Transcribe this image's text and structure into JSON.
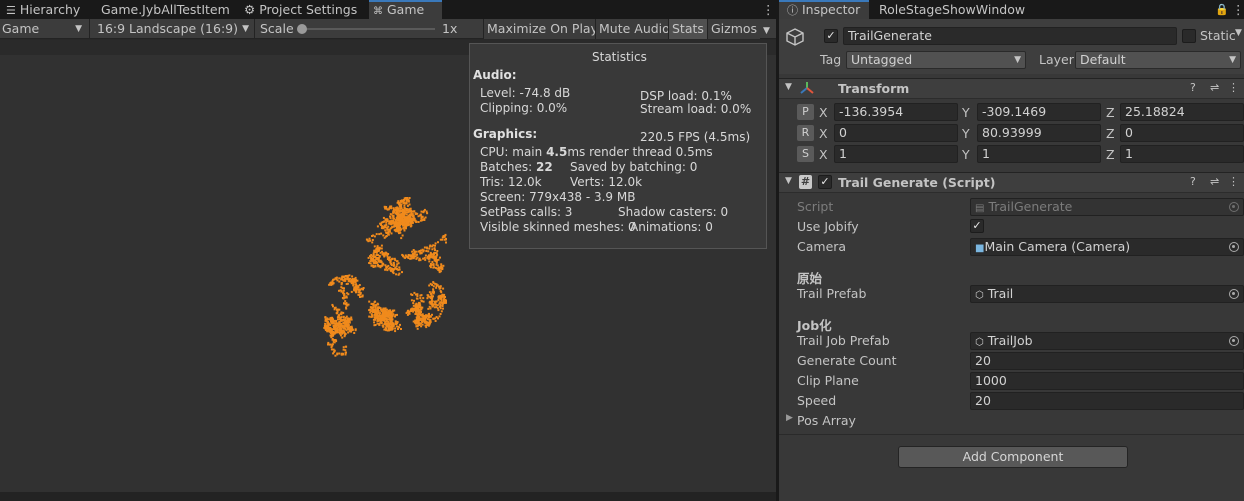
{
  "tabs_left": {
    "hierarchy": "Hierarchy",
    "game_jyb": "Game.JybAllTestItem",
    "project_settings": "Project Settings",
    "game": "Game"
  },
  "toolbar": {
    "display": "Game",
    "aspect": "16:9 Landscape (16:9)",
    "scale_label": "Scale",
    "scale_value": "1x",
    "maximize": "Maximize On Play",
    "mute": "Mute Audio",
    "stats": "Stats",
    "gizmos": "Gizmos"
  },
  "stats": {
    "title": "Statistics",
    "audio_header": "Audio:",
    "level": "Level: -74.8 dB",
    "clipping": "Clipping: 0.0%",
    "dsp": "DSP load: 0.1%",
    "stream": "Stream load: 0.0%",
    "graphics_header": "Graphics:",
    "fps": "220.5 FPS (4.5ms)",
    "cpu_prefix": "CPU: main ",
    "cpu_main": "4.5",
    "cpu_suffix": "ms  render thread 0.5ms",
    "batches_prefix": "Batches: ",
    "batches": "22",
    "saved": "Saved by batching: 0",
    "tris": "Tris: 12.0k",
    "verts": "Verts: 12.0k",
    "screen": "Screen: 779x438 - 3.9 MB",
    "setpass": "SetPass calls: 3",
    "shadow": "Shadow casters: 0",
    "skinned": "Visible skinned meshes: 0",
    "animations": "Animations: 0"
  },
  "tabs_right": {
    "inspector": "Inspector",
    "role": "RoleStageShowWindow"
  },
  "object": {
    "name": "TrailGenerate",
    "static": "Static",
    "tag_label": "Tag",
    "tag": "Untagged",
    "layer_label": "Layer",
    "layer": "Default"
  },
  "transform": {
    "title": "Transform",
    "rows": [
      {
        "btn": "P",
        "x": "-136.3954",
        "y": "-309.1469",
        "z": "25.18824"
      },
      {
        "btn": "R",
        "x": "0",
        "y": "80.93999",
        "z": "0"
      },
      {
        "btn": "S",
        "x": "1",
        "y": "1",
        "z": "1"
      }
    ],
    "x_axis": "X",
    "y_axis": "Y",
    "z_axis": "Z"
  },
  "script": {
    "title": "Trail Generate (Script)",
    "script_label": "Script",
    "script_value": "TrailGenerate",
    "use_jobify_label": "Use Jobify",
    "camera_label": "Camera",
    "camera_value": "Main Camera (Camera)",
    "section_original": "原始",
    "trail_prefab_label": "Trail Prefab",
    "trail_prefab_value": "Trail",
    "section_job": "Job化",
    "trail_job_prefab_label": "Trail Job Prefab",
    "trail_job_prefab_value": "TrailJob",
    "generate_count_label": "Generate Count",
    "generate_count_value": "20",
    "clip_plane_label": "Clip Plane",
    "clip_plane_value": "1000",
    "speed_label": "Speed",
    "speed_value": "20",
    "pos_array_label": "Pos Array"
  },
  "add_component": "Add Component",
  "colors": {
    "accent": "#3a79bb",
    "trail": "#f08a1c"
  }
}
